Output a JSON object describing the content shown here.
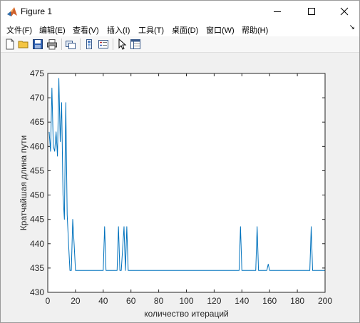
{
  "window": {
    "title": "Figure 1",
    "controls": [
      "minimize",
      "maximize",
      "close"
    ]
  },
  "menubar": {
    "items": [
      {
        "label": "文件(F)"
      },
      {
        "label": "编辑(E)"
      },
      {
        "label": "查看(V)"
      },
      {
        "label": "插入(I)"
      },
      {
        "label": "工具(T)"
      },
      {
        "label": "桌面(D)"
      },
      {
        "label": "窗口(W)"
      },
      {
        "label": "帮助(H)"
      }
    ],
    "overflow_icon": "chevron-arrow-icon"
  },
  "toolbar": {
    "buttons": [
      "new-figure-icon",
      "open-file-icon",
      "save-icon",
      "print-icon",
      "link-plot-icon",
      "insert-colorbar-icon",
      "insert-legend-icon",
      "pointer-icon",
      "property-inspector-icon"
    ]
  },
  "colors": {
    "line": "#0072bd",
    "axes_bg": "#ffffff",
    "figure_bg": "#f0f0f0"
  },
  "chart_data": {
    "type": "line",
    "title": "",
    "xlabel": "количество итераций",
    "ylabel": "Кратчайшая длина пути",
    "xlim": [
      0,
      200
    ],
    "ylim": [
      430,
      475
    ],
    "xticks": [
      0,
      20,
      40,
      60,
      80,
      100,
      120,
      140,
      160,
      180,
      200
    ],
    "yticks": [
      430,
      435,
      440,
      445,
      450,
      455,
      460,
      465,
      470,
      475
    ],
    "grid": false,
    "x": [
      1,
      2,
      3,
      4,
      5,
      6,
      7,
      8,
      9,
      10,
      11,
      12,
      13,
      14,
      15,
      16,
      17,
      18,
      19,
      20,
      21,
      22,
      25,
      30,
      35,
      40,
      41,
      42,
      45,
      50,
      51,
      52,
      53,
      55,
      56,
      57,
      58,
      60,
      70,
      80,
      90,
      100,
      110,
      120,
      130,
      138,
      139,
      140,
      145,
      150,
      151,
      152,
      155,
      158,
      159,
      160,
      165,
      170,
      175,
      180,
      185,
      189,
      190,
      191,
      195,
      200
    ],
    "series": [
      {
        "values": [
          463,
          459,
          472,
          460,
          459,
          463,
          458,
          474,
          461,
          469,
          450,
          445,
          469,
          446,
          440,
          434.5,
          434.5,
          445,
          440,
          434.5,
          434.5,
          434.5,
          434.5,
          434.5,
          434.5,
          434.5,
          443.5,
          434.5,
          434.5,
          434.5,
          443.5,
          434.5,
          434.5,
          443.5,
          434.5,
          443.5,
          434.5,
          434.5,
          434.5,
          434.5,
          434.5,
          434.5,
          434.5,
          434.5,
          434.5,
          434.5,
          443.5,
          434.5,
          434.5,
          434.5,
          443.5,
          434.5,
          434.5,
          434.5,
          435.8,
          434.5,
          434.5,
          434.5,
          434.5,
          434.5,
          434.5,
          434.5,
          443.5,
          434.5,
          434.5,
          434.5
        ]
      }
    ]
  }
}
